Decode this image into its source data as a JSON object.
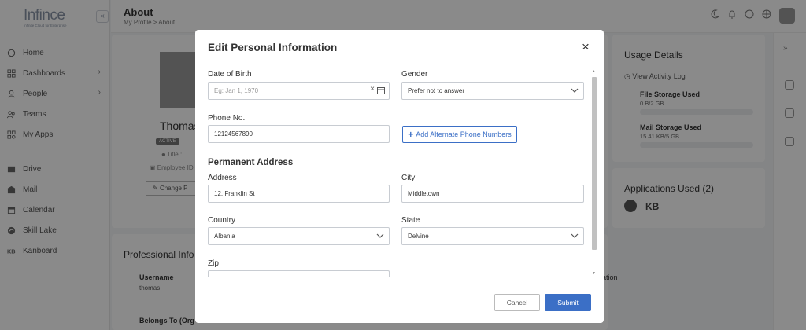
{
  "brand": {
    "name": "Infince",
    "tagline": "Infinite Cloud for Enterprise"
  },
  "sidebar": {
    "collapse_icon": "«",
    "items": [
      {
        "label": "Home",
        "icon": "home-icon"
      },
      {
        "label": "Dashboards",
        "icon": "dashboard-icon",
        "chevron": "›"
      },
      {
        "label": "People",
        "icon": "people-icon",
        "chevron": "›"
      },
      {
        "label": "Teams",
        "icon": "teams-icon"
      },
      {
        "label": "My Apps",
        "icon": "apps-icon"
      },
      {
        "label": "Drive",
        "icon": "drive-icon"
      },
      {
        "label": "Mail",
        "icon": "mail-icon"
      },
      {
        "label": "Calendar",
        "icon": "calendar-icon"
      },
      {
        "label": "Skill Lake",
        "icon": "skill-lake-icon"
      },
      {
        "label": "Kanboard",
        "icon": "kanboard-icon"
      }
    ]
  },
  "header": {
    "title": "About",
    "breadcrumb": [
      "My Profile",
      "About"
    ],
    "crumb_sep": ">"
  },
  "profile": {
    "name": "Thomas",
    "status_badge": "ACTIVE",
    "title_text": "Title : ",
    "employee_text": "Employee ID",
    "change_password": "Change P"
  },
  "professional": {
    "heading": "Professional Info",
    "username_label": "Username",
    "username_value": "thomas",
    "belongs_label": "Belongs To (Org",
    "ation_fragment": "ation"
  },
  "usage": {
    "heading": "Usage Details",
    "activity_log": "View Activity Log",
    "file_storage_label": "File Storage Used",
    "file_storage_value": "0 B/2 GB",
    "file_storage_pct": 0,
    "mail_storage_label": "Mail Storage Used",
    "mail_storage_value": "15.41 KB/5 GB",
    "mail_storage_pct": 0
  },
  "apps": {
    "heading": "Applications Used (2)",
    "kb_label": "KB"
  },
  "modal": {
    "title": "Edit Personal Information",
    "close": "×",
    "dob_label": "Date of Birth",
    "dob_placeholder": "Eg: Jan 1, 1970",
    "dob_clear": "×",
    "gender_label": "Gender",
    "gender_value": "Prefer not to answer",
    "phone_label": "Phone No.",
    "phone_value": "12124567890",
    "add_phone": "Add Alternate Phone Numbers",
    "add_phone_plus": "+",
    "address_heading": "Permanent Address",
    "address_label": "Address",
    "address_value": "12, Franklin St",
    "city_label": "City",
    "city_value": "Middletown",
    "country_label": "Country",
    "country_value": "Albania",
    "state_label": "State",
    "state_value": "Delvine",
    "zip_label": "Zip",
    "cancel": "Cancel",
    "submit": "Submit"
  },
  "colors": {
    "accent": "#3b6fc6",
    "overlay": "rgba(0,0,0,0.46)"
  }
}
